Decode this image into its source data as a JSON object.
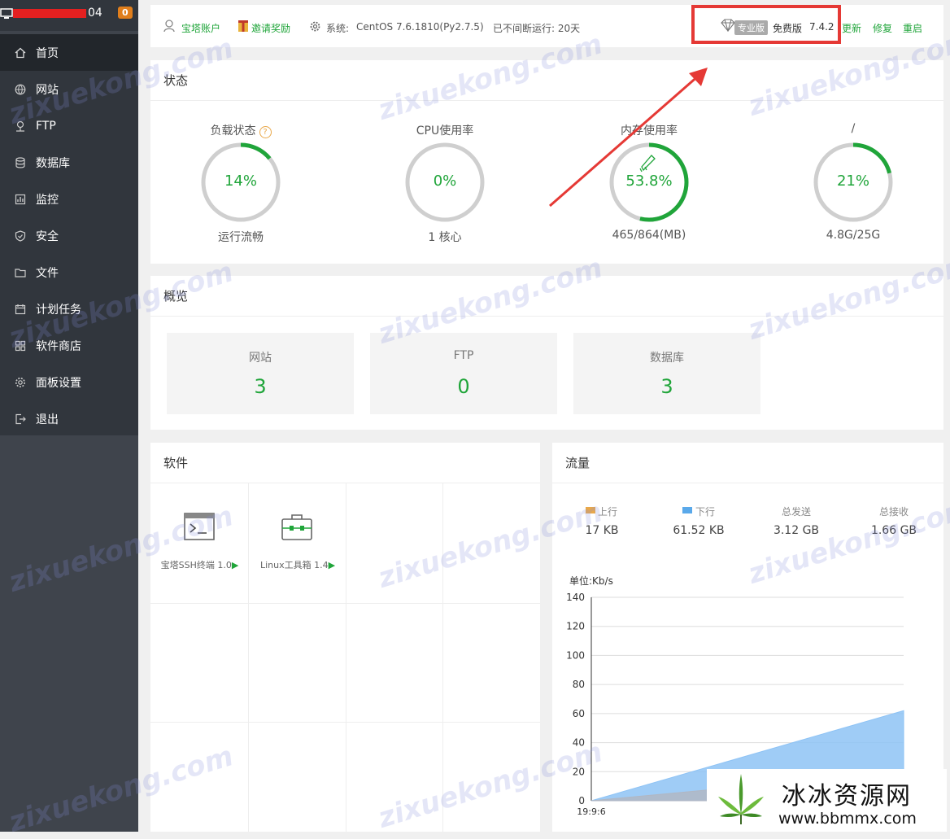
{
  "sidebar": {
    "server_name_suffix": "04",
    "badge": "0",
    "items": [
      {
        "label": "首页",
        "icon": "home-icon"
      },
      {
        "label": "网站",
        "icon": "globe-icon"
      },
      {
        "label": "FTP",
        "icon": "ftp-icon"
      },
      {
        "label": "数据库",
        "icon": "database-icon"
      },
      {
        "label": "监控",
        "icon": "monitor-icon"
      },
      {
        "label": "安全",
        "icon": "shield-icon"
      },
      {
        "label": "文件",
        "icon": "folder-icon"
      },
      {
        "label": "计划任务",
        "icon": "calendar-icon"
      },
      {
        "label": "软件商店",
        "icon": "grid-icon"
      },
      {
        "label": "面板设置",
        "icon": "gear-icon"
      },
      {
        "label": "退出",
        "icon": "logout-icon"
      }
    ]
  },
  "topbar": {
    "account": "宝塔账户",
    "invite": "邀请奖励",
    "system_label": "系统:",
    "system_value": "CentOS 7.6.1810(Py2.7.5)",
    "uptime": "已不间断运行: 20天",
    "pro_badge": "专业版",
    "edition": "免费版",
    "version": "7.4.2",
    "update": "更新",
    "repair": "修复",
    "restart": "重启"
  },
  "status": {
    "title": "状态",
    "gauges": [
      {
        "label": "负载状态",
        "value": "14%",
        "sub": "运行流畅",
        "fraction": 0.14
      },
      {
        "label": "CPU使用率",
        "value": "0%",
        "sub": "1 核心",
        "fraction": 0.0
      },
      {
        "label": "内存使用率",
        "value": "53.8%",
        "sub": "465/864(MB)",
        "fraction": 0.538
      },
      {
        "label": "/",
        "value": "21%",
        "sub": "4.8G/25G",
        "fraction": 0.21
      }
    ]
  },
  "overview": {
    "title": "概览",
    "cards": [
      {
        "label": "网站",
        "value": "3"
      },
      {
        "label": "FTP",
        "value": "0"
      },
      {
        "label": "数据库",
        "value": "3"
      }
    ]
  },
  "software": {
    "title": "软件",
    "items": [
      {
        "label": "宝塔SSH终端 1.0",
        "icon": "terminal-icon"
      },
      {
        "label": "Linux工具箱 1.4",
        "icon": "toolbox-icon"
      }
    ]
  },
  "traffic": {
    "title": "流量",
    "stats": [
      {
        "label": "上行",
        "value": "17 KB"
      },
      {
        "label": "下行",
        "value": "61.52 KB"
      },
      {
        "label": "总发送",
        "value": "3.12 GB"
      },
      {
        "label": "总接收",
        "value": "1.66 GB"
      }
    ],
    "unit": "单位:Kb/s"
  },
  "chart_data": {
    "type": "area",
    "title": "",
    "ylabel": "单位:Kb/s",
    "x": [
      "19:9:6",
      ""
    ],
    "ylim": [
      0,
      140
    ],
    "yticks": [
      0,
      20,
      40,
      60,
      80,
      100,
      120,
      140
    ],
    "series": [
      {
        "name": "下行",
        "color": "#8ec3f5",
        "values": [
          0,
          62
        ]
      },
      {
        "name": "上行",
        "color": "#b0b7c4",
        "values": [
          0,
          20
        ]
      }
    ]
  },
  "watermarks": {
    "text": "zixuekong.com",
    "brand_cn": "冰冰资源网",
    "brand_url": "www.bbmmx.com"
  },
  "colors": {
    "accent": "#20a53a",
    "sidebar": "#3f444c",
    "badge": "#e07e1c",
    "highlight": "#e53935"
  }
}
